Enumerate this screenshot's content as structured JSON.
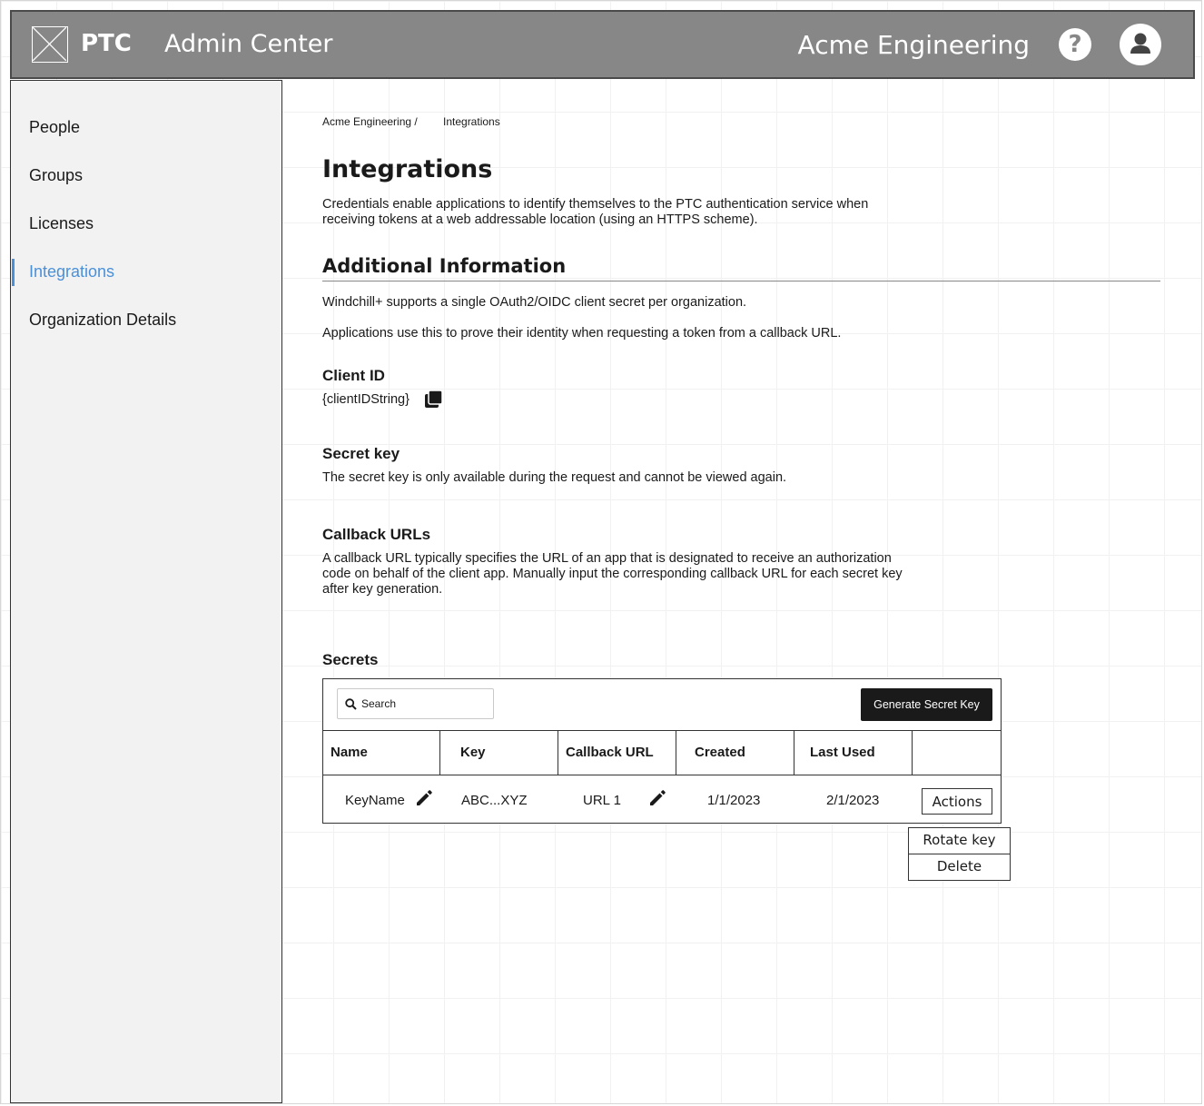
{
  "header": {
    "brand": "PTC",
    "app_title": "Admin Center",
    "org_name": "Acme Engineering",
    "help_icon": "help-circle-icon",
    "avatar_icon": "user-avatar-icon",
    "logo_icon": "placeholder-logo-icon"
  },
  "sidebar": {
    "items": [
      {
        "label": "People"
      },
      {
        "label": "Groups"
      },
      {
        "label": "Licenses"
      },
      {
        "label": "Integrations",
        "active": true
      },
      {
        "label": "Organization Details"
      }
    ],
    "active_color": "#4a90d9"
  },
  "breadcrumb": {
    "parent": "Acme Engineering /",
    "current": "Integrations"
  },
  "page": {
    "title": "Integrations",
    "description": "Credentials enable applications to identify themselves to the PTC authentication service when receiving tokens at a web addressable location (using an HTTPS scheme)."
  },
  "additional_info": {
    "heading": "Additional Information",
    "line1": "Windchill+ supports a single OAuth2/OIDC client secret per organization.",
    "line2": "Applications use this to prove their identity when requesting a token from a callback URL."
  },
  "client_id": {
    "heading": "Client ID",
    "value": "{clientIDString}",
    "copy_icon": "copy-icon"
  },
  "secret_key": {
    "heading": "Secret key",
    "text": "The secret key is only available during the request and cannot be viewed again."
  },
  "callback_urls": {
    "heading": "Callback URLs",
    "text": "A callback URL typically specifies the URL of an app that is designated to receive an authorization code on behalf of the client app. Manually input the corresponding callback URL for each secret key after key generation."
  },
  "secrets": {
    "heading": "Secrets",
    "search_placeholder": "Search",
    "generate_label": "Generate Secret Key",
    "columns": [
      "Name",
      "Key",
      "Callback URL",
      "Created",
      "Last Used",
      ""
    ],
    "rows": [
      {
        "name": "KeyName",
        "key": "ABC...XYZ",
        "callback_url": "URL 1",
        "created": "1/1/2023",
        "last_used": "2/1/2023"
      }
    ],
    "actions_label": "Actions",
    "menu": [
      "Rotate key",
      "Delete"
    ]
  }
}
